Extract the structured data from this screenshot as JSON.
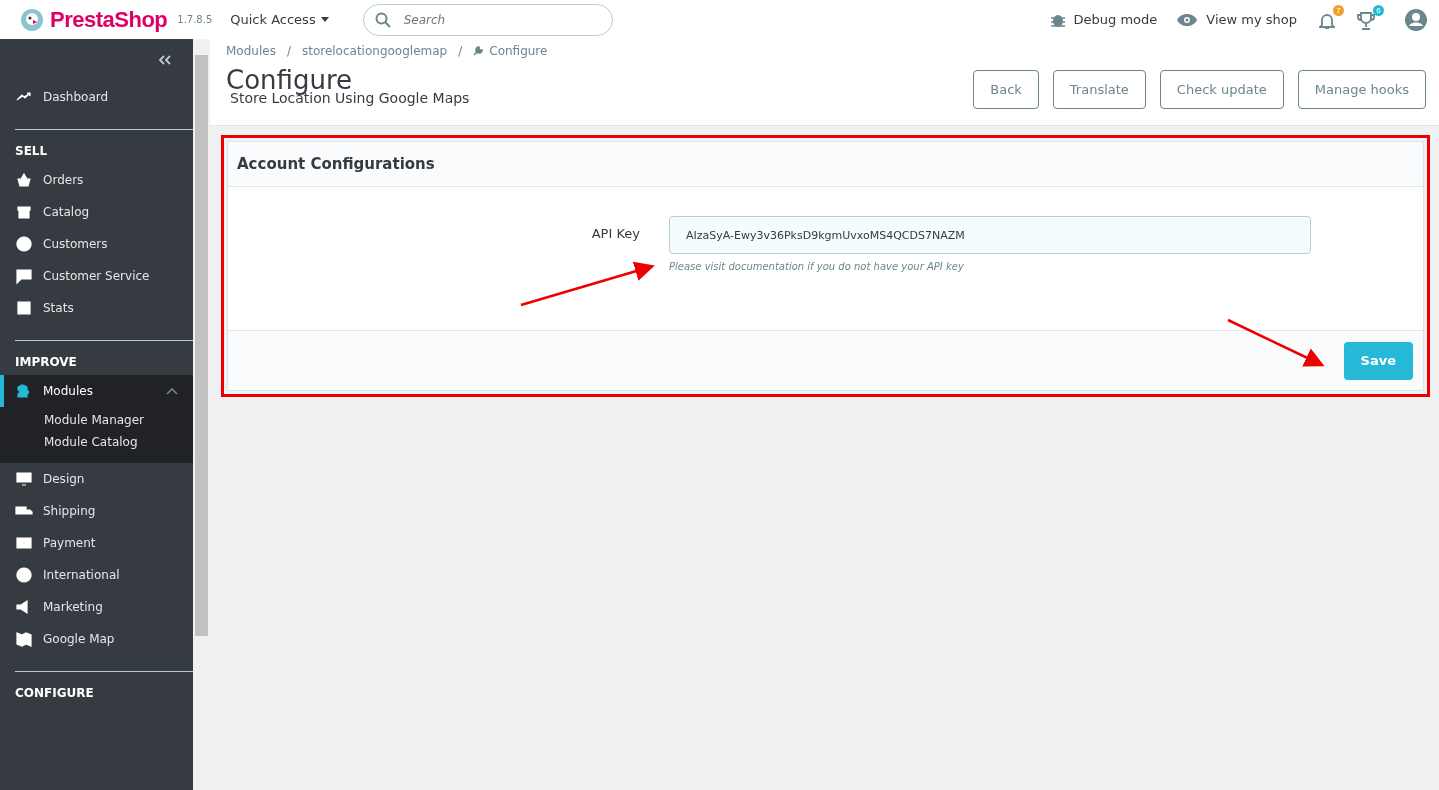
{
  "header": {
    "logo": "PrestaShop",
    "version": "1.7.8.5",
    "quick_access": "Quick Access",
    "search": {
      "placeholder": "Search"
    },
    "debug": "Debug mode",
    "view_shop": "View my shop",
    "notifications": {
      "count": "7",
      "color": "#f0a030"
    },
    "trophies": {
      "count": "6",
      "color": "#25b9d7"
    }
  },
  "sidebar": {
    "sections": [
      {
        "items": [
          {
            "label": "Dashboard",
            "selected": false
          }
        ]
      },
      {
        "heading": "SELL",
        "items": [
          {
            "label": "Orders",
            "selected": false
          },
          {
            "label": "Catalog",
            "selected": false
          },
          {
            "label": "Customers",
            "selected": false
          },
          {
            "label": "Customer Service",
            "selected": false
          },
          {
            "label": "Stats",
            "selected": false
          }
        ]
      },
      {
        "heading": "IMPROVE",
        "items": [
          {
            "label": "Modules",
            "selected": true,
            "expanded": true,
            "children": [
              {
                "label": "Module Manager"
              },
              {
                "label": "Module Catalog"
              }
            ]
          },
          {
            "label": "Design",
            "selected": false
          },
          {
            "label": "Shipping",
            "selected": false
          },
          {
            "label": "Payment",
            "selected": false
          },
          {
            "label": "International",
            "selected": false
          },
          {
            "label": "Marketing",
            "selected": false
          },
          {
            "label": "Google Map",
            "selected": false
          }
        ]
      },
      {
        "heading": "CONFIGURE"
      }
    ]
  },
  "breadcrumb": {
    "separator": "/",
    "items": [
      "Modules",
      "storelocationgooglemap",
      "Configure"
    ]
  },
  "page": {
    "title": "Configure",
    "subtitle": "Store Location Using Google Maps",
    "buttons": [
      "Back",
      "Translate",
      "Check update",
      "Manage hooks"
    ]
  },
  "panel": {
    "title": "Account Configurations",
    "fields": [
      {
        "label": "API Key",
        "value": "AIzaSyA-Ewy3v36PksD9kgmUvxoMS4QCDS7NAZM",
        "help": "Please visit documentation if you do not have your API key"
      }
    ],
    "save": "Save"
  }
}
